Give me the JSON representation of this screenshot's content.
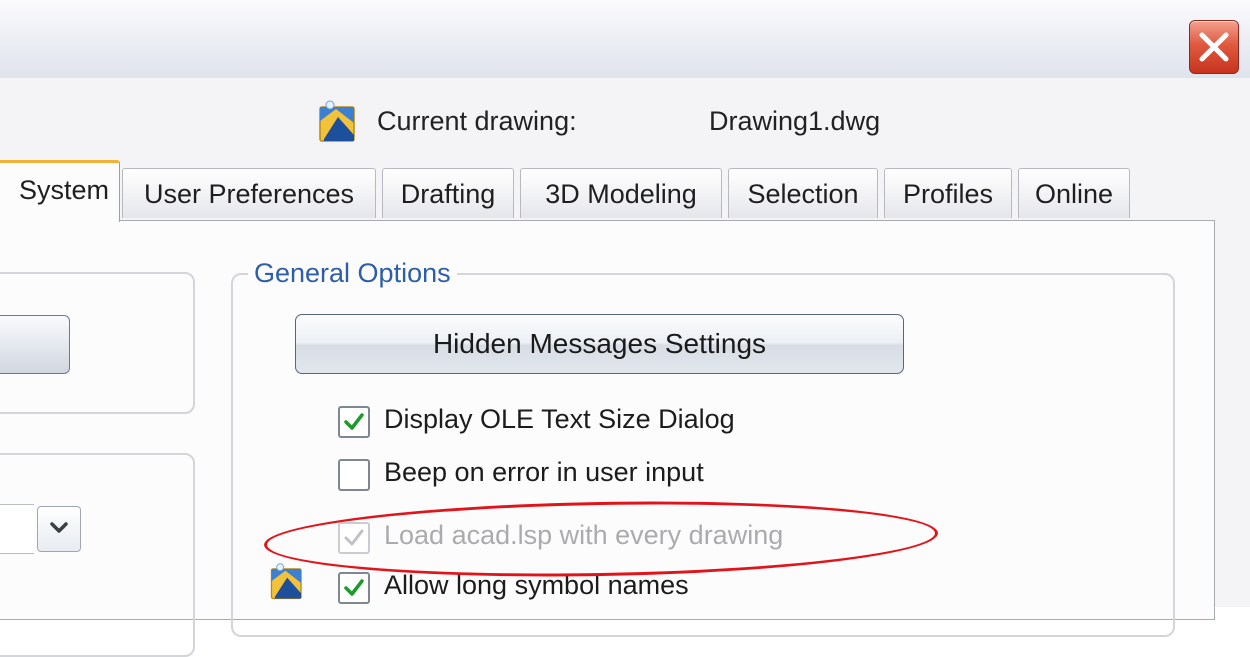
{
  "window": {
    "close_label": "Close"
  },
  "header": {
    "current_label": "Current drawing:",
    "current_value": "Drawing1.dwg",
    "icon": "drawing-icon"
  },
  "tabs": [
    {
      "label": "System",
      "active": true
    },
    {
      "label": "User Preferences",
      "active": false
    },
    {
      "label": "Drafting",
      "active": false
    },
    {
      "label": "3D Modeling",
      "active": false
    },
    {
      "label": "Selection",
      "active": false
    },
    {
      "label": "Profiles",
      "active": false
    },
    {
      "label": "Online",
      "active": false
    }
  ],
  "general_options": {
    "legend": "General Options",
    "hidden_messages_button": "Hidden Messages Settings",
    "options": [
      {
        "label": "Display OLE Text Size Dialog",
        "checked": true,
        "enabled": true
      },
      {
        "label": "Beep on error in user input",
        "checked": false,
        "enabled": true
      },
      {
        "label": "Load acad.lsp with every drawing",
        "checked": true,
        "enabled": false
      },
      {
        "label": "Allow long symbol names",
        "checked": true,
        "enabled": true
      }
    ]
  },
  "colors": {
    "legend_text": "#2e5ea7",
    "active_tab_accent": "#f2b23a",
    "close_button": "#d8472d",
    "annotation_circle": "#e2141b",
    "checkmark": "#1c9a2a"
  }
}
